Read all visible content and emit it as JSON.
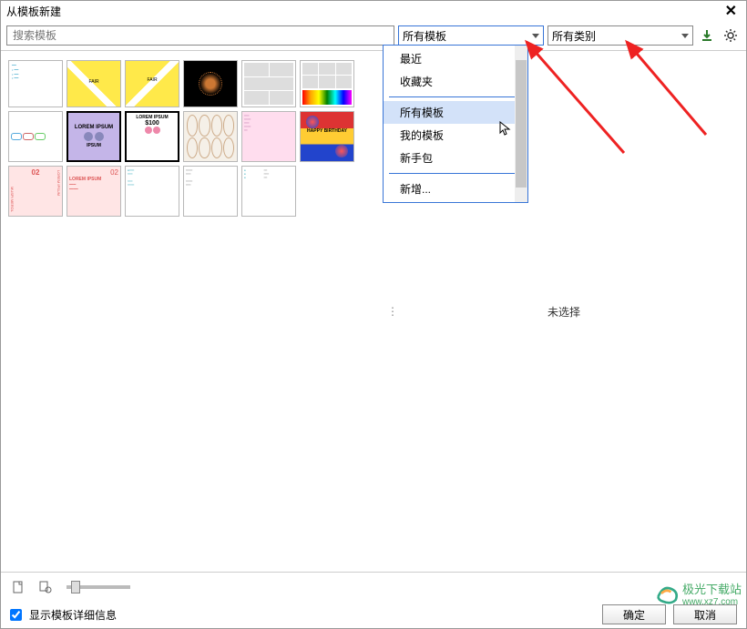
{
  "title": "从模板新建",
  "search": {
    "placeholder": "搜索模板"
  },
  "template_dropdown": {
    "label": "所有模板"
  },
  "category_dropdown": {
    "label": "所有类别"
  },
  "dropdown_menu": {
    "recent": "最近",
    "favorites": "收藏夹",
    "all_templates": "所有模板",
    "my_templates": "我的模板",
    "starter_pack": "新手包",
    "new": "新增..."
  },
  "preview": {
    "none": "未选择"
  },
  "show_details_label": "显示模板详细信息",
  "buttons": {
    "ok": "确定",
    "cancel": "取消"
  },
  "watermark": {
    "name": "极光下载站",
    "url": "www.xz7.com"
  },
  "thumbs": {
    "t6_fair": "FAIR",
    "t7_li": "LOREM IPSUM",
    "t8_li": "LOREM IPSUM",
    "t8_price": "$100",
    "t10_hb": "HAPPY BIRTHDAY",
    "t11a": "LOREM IPSUM",
    "t11b": "02",
    "t11c": "MUSPI MEROL",
    "t12a": "02",
    "t12b": "LOREM IPSUM"
  }
}
